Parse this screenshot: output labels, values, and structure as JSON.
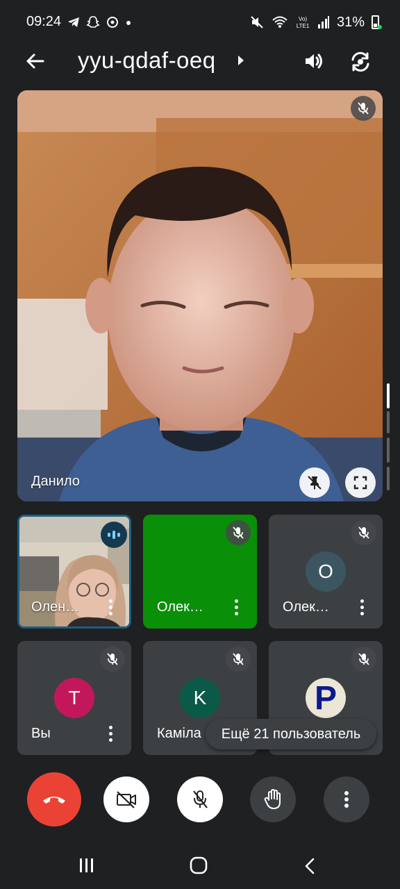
{
  "status_bar": {
    "time": "09:24",
    "left_icons": [
      "telegram-icon",
      "snapchat-icon",
      "sync-icon",
      "dot-icon"
    ],
    "right_icons": [
      "mute-icon",
      "wifi-icon",
      "volte-icon",
      "signal-icon"
    ],
    "battery_text": "31%"
  },
  "app_bar": {
    "meeting_code": "yyu-qdaf-oeq"
  },
  "main_speaker": {
    "name": "Данило"
  },
  "participants": [
    {
      "name": "Олен…",
      "type": "video",
      "speaking": true,
      "accent": "#1a73a8"
    },
    {
      "name": "Олек…",
      "type": "color",
      "bg": "#0a8f08",
      "muted": true
    },
    {
      "name": "Олек…",
      "type": "avatar",
      "initial": "O",
      "avatar_bg": "#3c5560",
      "muted": true
    },
    {
      "name": "Вы",
      "type": "avatar",
      "initial": "T",
      "avatar_bg": "#c2185b",
      "muted": true
    },
    {
      "name": "Каміла",
      "type": "avatar",
      "initial": "K",
      "avatar_bg": "#0b5a48",
      "muted": true
    },
    {
      "name": "",
      "type": "avatar-image",
      "initial": "P",
      "muted": true
    }
  ],
  "more_participants": "Ещё 21 пользователь",
  "controls": [
    "end-call",
    "camera-off",
    "mic-off",
    "raise-hand",
    "more-options"
  ],
  "colors": {
    "end_call": "#ea4335",
    "background": "#1f2022",
    "tile": "#3c4043"
  }
}
